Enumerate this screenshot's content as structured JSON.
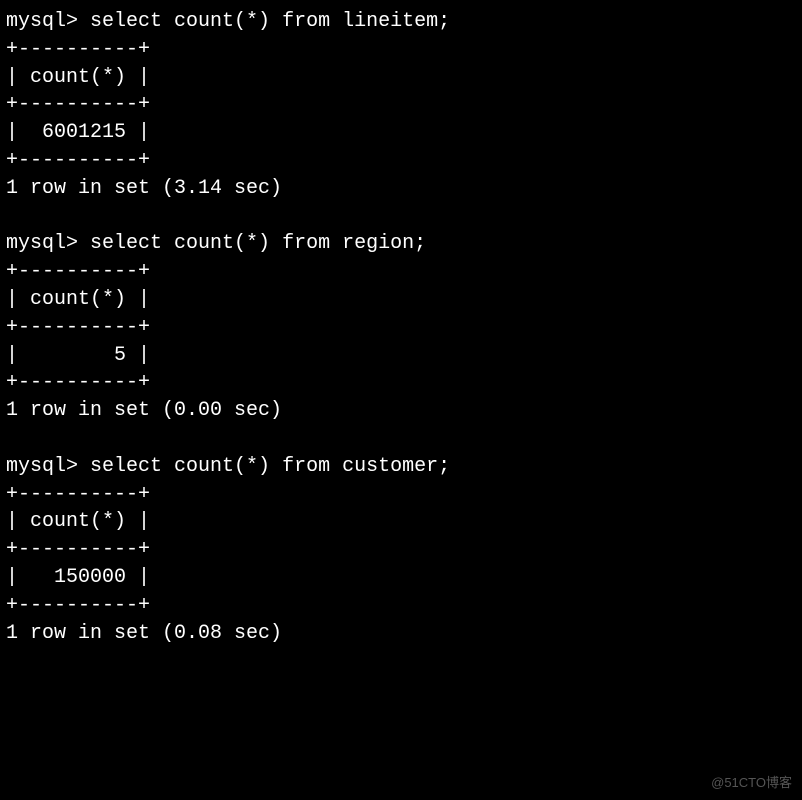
{
  "prompt": "mysql>",
  "border_top": "+----------+",
  "header_row": "| count(*) |",
  "queries": [
    {
      "command": "select count(*) from lineitem;",
      "value_row": "|  6001215 |",
      "status": "1 row in set (3.14 sec)"
    },
    {
      "command": "select count(*) from region;",
      "value_row": "|        5 |",
      "status": "1 row in set (0.00 sec)"
    },
    {
      "command": "select count(*) from customer;",
      "value_row": "|   150000 |",
      "status": "1 row in set (0.08 sec)"
    }
  ],
  "watermark": "@51CTO博客"
}
